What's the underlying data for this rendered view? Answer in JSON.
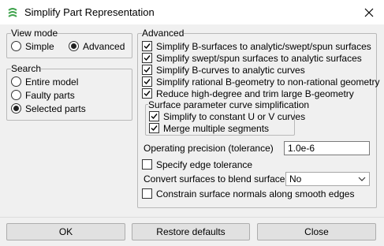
{
  "window": {
    "title": "Simplify Part Representation"
  },
  "view_mode": {
    "title": "View mode",
    "options": [
      {
        "label": "Simple",
        "selected": false
      },
      {
        "label": "Advanced",
        "selected": true
      }
    ]
  },
  "search": {
    "title": "Search",
    "options": [
      {
        "label": "Entire model",
        "selected": false
      },
      {
        "label": "Faulty parts",
        "selected": false
      },
      {
        "label": "Selected parts",
        "selected": true
      }
    ]
  },
  "advanced": {
    "title": "Advanced",
    "checks": [
      {
        "label": "Simplify B-surfaces to analytic/swept/spun surfaces",
        "checked": true
      },
      {
        "label": "Simplify swept/spun surfaces to analytic surfaces",
        "checked": true
      },
      {
        "label": "Simplify B-curves to analytic curves",
        "checked": true
      },
      {
        "label": "Simplify rational B-geometry to non-rational geometry",
        "checked": true
      },
      {
        "label": "Reduce high-degree and trim large B-geometry",
        "checked": true
      }
    ],
    "surface_param": {
      "title": "Surface parameter curve simplification",
      "checks": [
        {
          "label": "Simplify to constant U or V curves",
          "checked": true
        },
        {
          "label": "Merge multiple segments",
          "checked": true
        }
      ]
    },
    "precision_label": "Operating precision (tolerance)",
    "precision_value": "1.0e-6",
    "edge_tolerance": {
      "label": "Specify edge tolerance",
      "checked": false
    },
    "blend_label": "Convert surfaces to blend surfaces",
    "blend_value": "No",
    "constrain_normals": {
      "label": "Constrain surface normals along smooth edges",
      "checked": false
    }
  },
  "buttons": {
    "ok": "OK",
    "restore": "Restore defaults",
    "close": "Close"
  },
  "icons": {
    "app": "simplify-app-icon",
    "close": "close-icon",
    "dropdown": "chevron-down-icon",
    "check": "checkmark-icon"
  },
  "colors": {
    "dialog_bg": "#f0f0f0",
    "app_icon": "#3fa34d",
    "button_bg": "#e1e1e1"
  }
}
